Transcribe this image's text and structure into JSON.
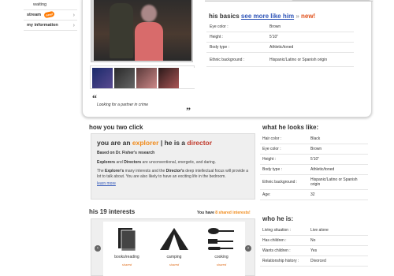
{
  "sidebar": {
    "items": [
      {
        "label": "waiting",
        "type": "sub"
      },
      {
        "label": "stream",
        "type": "bold",
        "badge": "new!"
      },
      {
        "label": "my information",
        "type": "bold"
      }
    ]
  },
  "profile": {
    "quote": "Looking for a partner in crime",
    "basics": {
      "heading": "his basics",
      "see_more": "see more like him",
      "see_more_suffix": "»",
      "new_label": "new!",
      "rows": [
        {
          "k": "Eye color :",
          "v": "Brown"
        },
        {
          "k": "Height :",
          "v": "5'10\""
        },
        {
          "k": "Body type :",
          "v": "Athletic/toned"
        },
        {
          "k": "Ethnic background :",
          "v": "Hispanic/Latino or Spanish origin"
        }
      ]
    }
  },
  "click": {
    "heading": "how you two click",
    "title_prefix": "you are an",
    "you_type": "explorer",
    "title_mid": "| he is a",
    "his_type": "director",
    "research": "Based on Dr. Fisher's research",
    "p1_a": "Explorers",
    "p1_b": "and",
    "p1_c": "Directors",
    "p1_d": "are unconventional, energetic, and daring.",
    "p2_a": "The",
    "p2_b": "Explorer's",
    "p2_c": "many interests and the",
    "p2_d": "Director's",
    "p2_e": "deep intellectual focus will provide a lot to talk about. You are also likely to have an exciting life in the bedroom.",
    "learn_more": "learn more"
  },
  "interests": {
    "heading": "his 19 interests",
    "you_have": "You have",
    "shared_count": "8 shared interests!",
    "items": [
      {
        "label": "books/reading",
        "shared": "shared",
        "icon": "books-icon"
      },
      {
        "label": "camping",
        "shared": "shared",
        "icon": "tent-icon"
      },
      {
        "label": "cooking",
        "shared": "shared",
        "icon": "cooking-icon"
      }
    ]
  },
  "looks": {
    "heading": "what he looks like:",
    "rows": [
      {
        "k": "Hair color :",
        "v": "Black"
      },
      {
        "k": "Eye color :",
        "v": "Brown"
      },
      {
        "k": "Height :",
        "v": "5'10\""
      },
      {
        "k": "Body type :",
        "v": "Athletic/toned"
      },
      {
        "k": "Ethnic background :",
        "v": "Hispanic/Latino or Spanish origin"
      },
      {
        "k": "Age:",
        "v": "32"
      }
    ]
  },
  "who": {
    "heading": "who he is:",
    "rows": [
      {
        "k": "Living situation :",
        "v": "Live alone"
      },
      {
        "k": "Has children :",
        "v": "No"
      },
      {
        "k": "Wants children :",
        "v": "Yes"
      },
      {
        "k": "Relationship history :",
        "v": "Divorced"
      }
    ]
  },
  "colors": {
    "accent_orange": "#f08a1a",
    "director_red": "#c0392b",
    "link_blue": "#2f55b8"
  }
}
